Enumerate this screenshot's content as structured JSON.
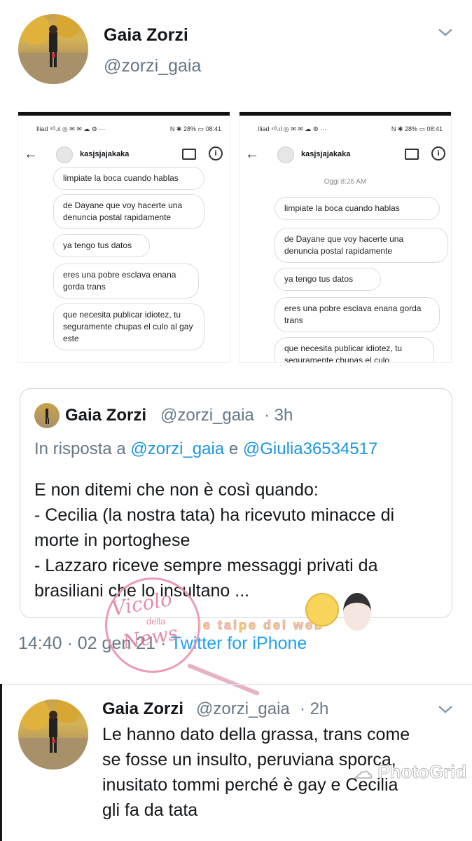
{
  "tweet": {
    "name": "Gaia Zorzi",
    "handle": "@zorzi_gaia",
    "time": "14:40",
    "date": "· 02 gen 21",
    "source": "Twitter for iPhone"
  },
  "screenshots": {
    "status_left": "Iliad ⁴ᴳ.ıl ◎ ✉ ✉ ☁ ⚙ ···",
    "status_right": "N ✱ 28% ▭ 08:41",
    "contact": "kasjsjajakaka",
    "left_messages": [
      "limpiate la boca cuando hablas",
      "de Dayane que voy hacerte una denuncia postal rapidamente",
      "ya tengo tus datos",
      "eres una pobre esclava enana gorda trans",
      "que necesita publicar idiotez, tu seguramente chupas el culo al gay este"
    ],
    "right_date": "Oggi 8:26 AM",
    "right_messages": [
      "limpiate la boca cuando hablas",
      "de Dayane que voy hacerte una denuncia postal rapidamente",
      "ya tengo tus datos",
      "eres una pobre esclava enana gorda trans",
      "que necesita publicar idiotez, tu seguramente chupas el culo"
    ]
  },
  "quote": {
    "name": "Gaia Zorzi",
    "handle": "@zorzi_gaia",
    "age": "· 3h",
    "reply_prefix": "In risposta a",
    "reply_user1": "@zorzi_gaia",
    "reply_and": "e",
    "reply_user2": "@Giulia36534517",
    "text": [
      "E non ditemi che non è così quando:",
      "- Cecilia (la nostra tata) ha ricevuto minacce di",
      "morte in portoghese",
      "- Lazzaro riceve sempre messaggi privati da",
      "brasiliani che lo insultano ..."
    ]
  },
  "watermark": {
    "brand1": "Vicolo",
    "brand2": "della",
    "brand3": "News",
    "brand4": "le talpe del web",
    "photogrid": "PhotoGrid"
  },
  "reply": {
    "name": "Gaia Zorzi",
    "handle": "@zorzi_gaia",
    "age": "· 2h",
    "text": [
      "Le hanno dato della grassa, trans come",
      "se fosse un insulto, peruviana sporca,",
      "inusitato tommi perché è gay e Cecilia",
      "gli fa da tata"
    ]
  },
  "colors": {
    "link": "#1da1f2",
    "muted": "#657786",
    "reply_link": "#1b95e0"
  }
}
